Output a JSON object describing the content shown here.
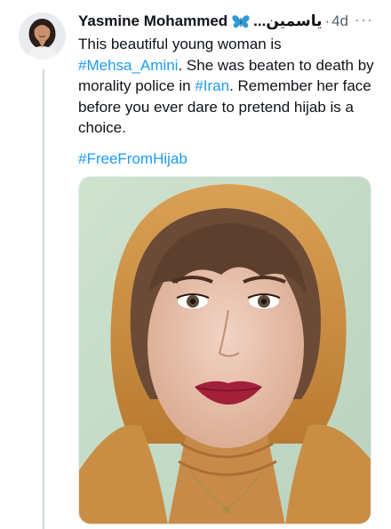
{
  "tweet": {
    "author_name": "Yasmine Mohammed",
    "author_name_arabic": "ياسمين...",
    "separator": "·",
    "timestamp": "4d",
    "more_label": "···",
    "text_part1": "This beautiful young woman is ",
    "hashtag_mehsa": "#Mehsa_Amini",
    "text_part2": ". She was beaten to death by morality police in ",
    "hashtag_iran": "#Iran",
    "text_part3": ". Remember her face before you ever dare to pretend hijab is a choice.",
    "hashtag_freefromhijab": "#FreeFromHijab"
  },
  "colors": {
    "link": "#1d9bf0",
    "secondary_text": "#536471",
    "thread_line": "#cfd9de",
    "butterfly": "#2d9bd6"
  },
  "icons": {
    "author_badge": "butterfly-icon",
    "more": "more-options-icon"
  }
}
